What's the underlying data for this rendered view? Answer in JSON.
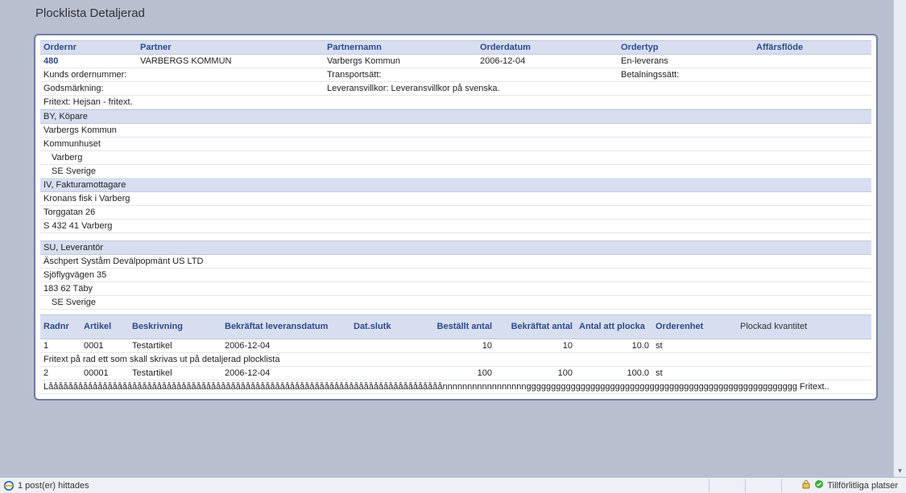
{
  "title": "Plocklista Detaljerad",
  "order_headers": {
    "ordernr": "Ordernr",
    "partner": "Partner",
    "partnernamn": "Partnernamn",
    "orderdatum": "Orderdatum",
    "ordertyp": "Ordertyp",
    "affarsflode": "Affärsflöde"
  },
  "order": {
    "ordernr": "480",
    "partner": "VARBERGS KOMMUN",
    "partnernamn": "Varbergs Kommun",
    "orderdatum": "2006-12-04",
    "ordertyp": "En-leverans",
    "affarsflode": ""
  },
  "labels": {
    "kunds_ordernummer": "Kunds ordernummer:",
    "transportsatt": "Transportsätt:",
    "betalningssatt": "Betalningssätt:",
    "godsmarkning": "Godsmärkning:",
    "leveransvillkor_full": "Leveransvillkor: Leveransvillkor på svenska.",
    "fritext_full": "Fritext: Hejsan - fritext."
  },
  "parties": {
    "by_header": "BY, Köpare",
    "by": [
      "Varbergs Kommun",
      "Kommunhuset",
      "Varberg",
      "SE Sverige"
    ],
    "iv_header": "IV, Fakturamottagare",
    "iv": [
      "Kronans fisk i Varberg",
      "Torggatan 26",
      "S 432 41 Varberg"
    ],
    "su_header": "SU, Leverantör",
    "su": [
      "Äschpert Syståm Devälpopmänt US LTD",
      "Sjöflygvägen 35",
      "183 62 Täby",
      "SE Sverige"
    ]
  },
  "line_headers": {
    "radnr": "Radnr",
    "artikel": "Artikel",
    "beskrivning": "Beskrivning",
    "bekraftat_leveransdatum": "Bekräftat leveransdatum",
    "dat_slutk": "Dat.slutk",
    "bestallt_antal": "Beställt antal",
    "bekraftat_antal": "Bekräftat antal",
    "antal_att_plocka": "Antal att plocka",
    "orderenhet": "Orderenhet",
    "plockad_kvantitet": "Plockad kvantitet"
  },
  "lines": [
    {
      "radnr": "1",
      "artikel": "0001",
      "beskrivning": "Testartikel",
      "bekraftat_leveransdatum": "2006-12-04",
      "dat_slutk": "",
      "bestallt_antal": "10",
      "bekraftat_antal": "10",
      "antal_att_plocka": "10.0",
      "orderenhet": "st",
      "plockad_kvantitet": "",
      "fritext": "Fritext på rad ett som skall skrivas ut på detaljerad plocklista"
    },
    {
      "radnr": "2",
      "artikel": "00001",
      "beskrivning": "Testartikel",
      "bekraftat_leveransdatum": "2006-12-04",
      "dat_slutk": "",
      "bestallt_antal": "100",
      "bekraftat_antal": "100",
      "antal_att_plocka": "100.0",
      "orderenhet": "st",
      "plockad_kvantitet": "",
      "fritext": "Låååååååååååååååååååååååååååååååååååååååååååååååååååååååååååååååååååååååååååååååånnnnnnnnnnnnnnnnnggggggggggggggggggggggggggggggggggggggggggggggggggggggg Fritext.."
    }
  ],
  "statusbar": {
    "left": "1 post(er) hittades",
    "trusted": "Tillförlitliga platser"
  }
}
